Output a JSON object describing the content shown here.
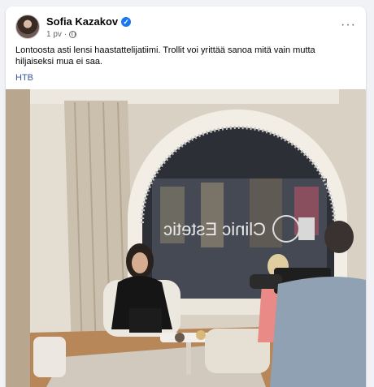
{
  "post": {
    "author": "Sofia Kazakov",
    "time": "1 pv",
    "separator": "·",
    "text": "Lontoosta asti lensi haastattelijatiimi.   Trollit voi yrittää sanoa mitä vain mutta hiljaiseksi mua ei saa.",
    "tag": "НТВ",
    "more_label": "···",
    "verified_symbol": "✓"
  },
  "photo": {
    "window_text": "Clinic Estetic"
  },
  "colors": {
    "verified": "#1877f2",
    "link": "#385898",
    "muted": "#65676b"
  },
  "icons": [
    "verified-badge-icon",
    "globe-icon",
    "more-options-icon"
  ]
}
